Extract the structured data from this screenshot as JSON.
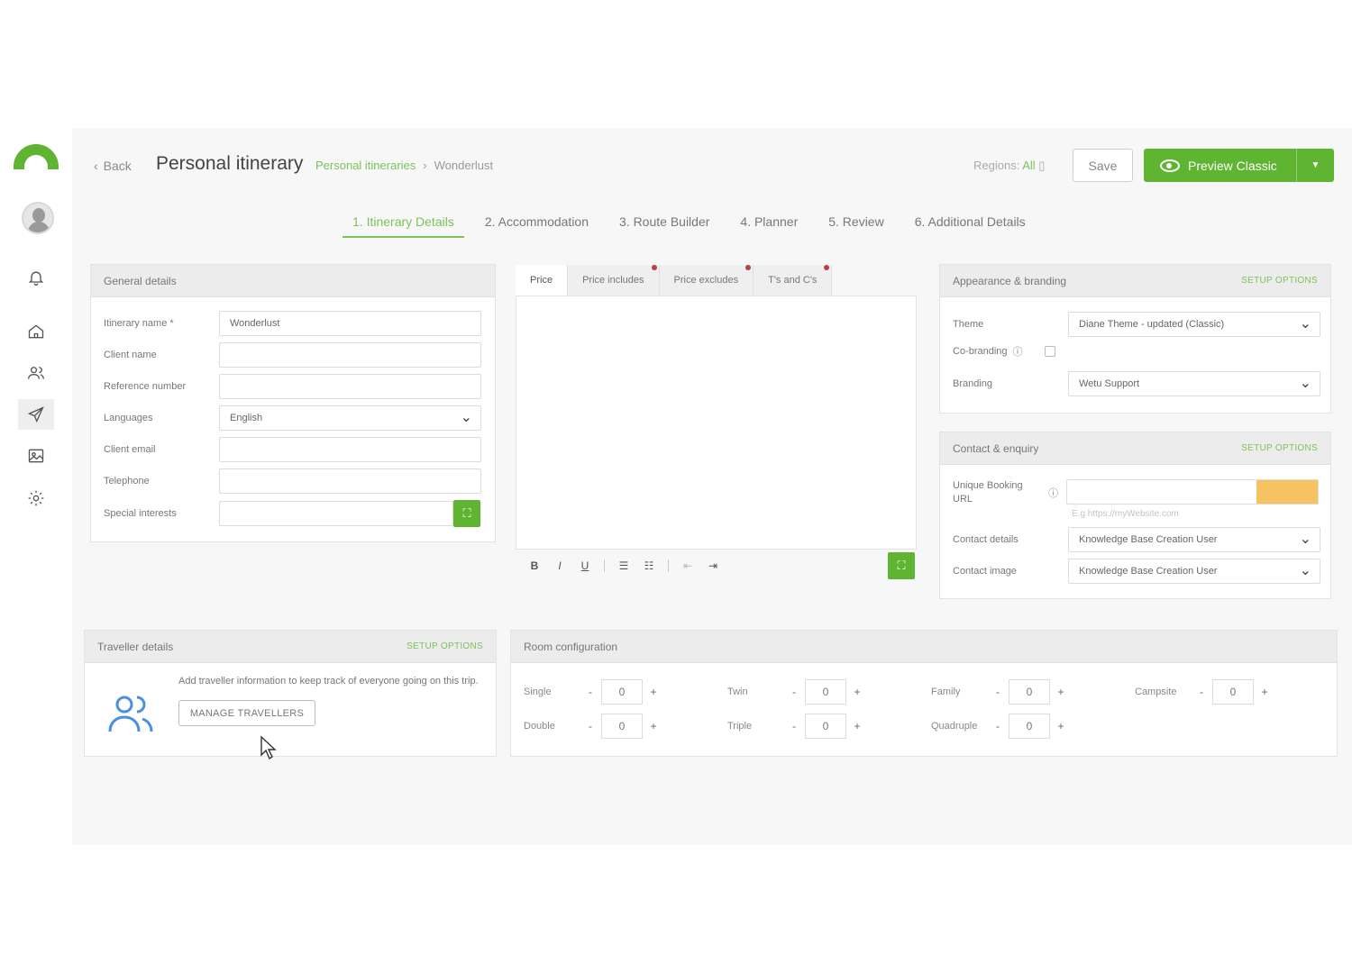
{
  "header": {
    "back_label": "Back",
    "title": "Personal itinerary",
    "breadcrumb_link": "Personal itineraries",
    "breadcrumb_sep": "›",
    "breadcrumb_current": "Wonderlust",
    "regions_label": "Regions:",
    "regions_value": "All",
    "save_label": "Save",
    "preview_label": "Preview Classic"
  },
  "sidebar": {
    "icons": [
      "bell-icon",
      "home-icon",
      "people-icon",
      "send-icon",
      "image-icon",
      "gear-icon"
    ]
  },
  "steps": [
    {
      "label": "1. Itinerary Details",
      "active": true
    },
    {
      "label": "2. Accommodation",
      "active": false
    },
    {
      "label": "3. Route Builder",
      "active": false
    },
    {
      "label": "4. Planner",
      "active": false
    },
    {
      "label": "5. Review",
      "active": false
    },
    {
      "label": "6. Additional Details",
      "active": false
    }
  ],
  "general": {
    "title": "General details",
    "fields": {
      "itinerary_name_label": "Itinerary name *",
      "itinerary_name_value": "Wonderlust",
      "client_name_label": "Client name",
      "reference_label": "Reference number",
      "languages_label": "Languages",
      "languages_value": "English",
      "client_email_label": "Client email",
      "telephone_label": "Telephone",
      "special_interests_label": "Special interests"
    }
  },
  "price_tabs": [
    {
      "label": "Price",
      "active": true,
      "dot": false
    },
    {
      "label": "Price includes",
      "active": false,
      "dot": true
    },
    {
      "label": "Price excludes",
      "active": false,
      "dot": true
    },
    {
      "label": "T's and C's",
      "active": false,
      "dot": true
    }
  ],
  "appearance": {
    "title": "Appearance & branding",
    "setup": "SETUP OPTIONS",
    "theme_label": "Theme",
    "theme_value": "Diane Theme - updated (Classic)",
    "cobranding_label": "Co-branding",
    "branding_label": "Branding",
    "branding_value": "Wetu Support"
  },
  "contact": {
    "title": "Contact & enquiry",
    "setup": "SETUP OPTIONS",
    "booking_label_1": "Unique Booking",
    "booking_label_2": "URL",
    "booking_hint": "E.g https://myWebsite.com",
    "contact_details_label": "Contact details",
    "contact_details_value": "Knowledge Base Creation User",
    "contact_image_label": "Contact image",
    "contact_image_value": "Knowledge Base Creation User"
  },
  "traveller": {
    "title": "Traveller details",
    "setup": "SETUP OPTIONS",
    "text": "Add traveller information to keep track of everyone going on this trip.",
    "button": "MANAGE TRAVELLERS"
  },
  "rooms": {
    "title": "Room configuration",
    "items": [
      {
        "label": "Single",
        "value": "0"
      },
      {
        "label": "Twin",
        "value": "0"
      },
      {
        "label": "Family",
        "value": "0"
      },
      {
        "label": "Campsite",
        "value": "0"
      },
      {
        "label": "Double",
        "value": "0"
      },
      {
        "label": "Triple",
        "value": "0"
      },
      {
        "label": "Quadruple",
        "value": "0"
      }
    ],
    "minus": "-",
    "plus": "+"
  },
  "colors": {
    "brand_green": "#5fb432",
    "accent_text": "#7cc25a",
    "dot_red": "#b14545",
    "booking_yellow": "#f5b33a"
  }
}
